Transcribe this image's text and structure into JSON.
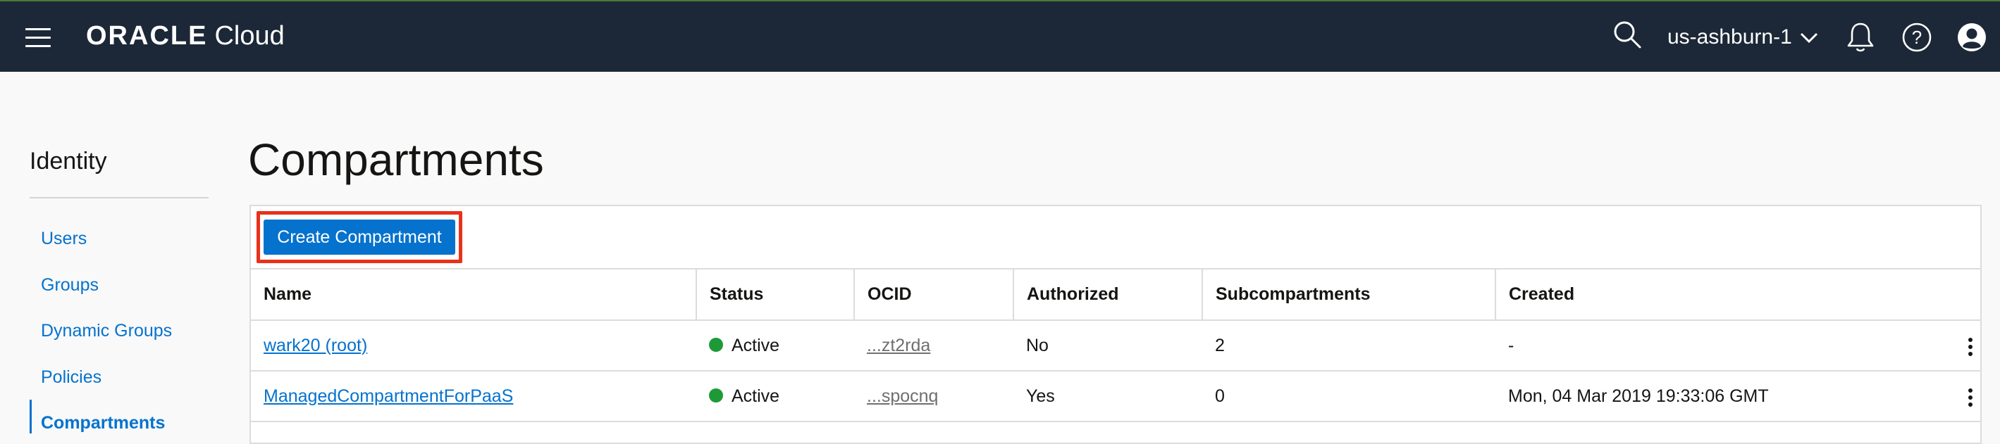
{
  "header": {
    "brand": "ORACLE",
    "product": "Cloud",
    "region": "us-ashburn-1",
    "icons": [
      "menu-icon",
      "search-icon",
      "chevron-down-icon",
      "bell-icon",
      "help-icon",
      "user-icon"
    ]
  },
  "sidebar": {
    "title": "Identity",
    "items": [
      {
        "label": "Users"
      },
      {
        "label": "Groups"
      },
      {
        "label": "Dynamic Groups"
      },
      {
        "label": "Policies"
      },
      {
        "label": "Compartments",
        "active": true
      }
    ]
  },
  "main": {
    "title": "Compartments",
    "create_button": "Create Compartment",
    "columns": [
      "Name",
      "Status",
      "OCID",
      "Authorized",
      "Subcompartments",
      "Created"
    ],
    "rows": [
      {
        "name": "wark20 (root)",
        "status": "Active",
        "ocid": "...zt2rda",
        "authorized": "No",
        "subcompartments": "2",
        "created": "-"
      },
      {
        "name": "ManagedCompartmentForPaaS",
        "status": "Active",
        "ocid": "...spocnq",
        "authorized": "Yes",
        "subcompartments": "0",
        "created": "Mon, 04 Mar 2019 19:33:06 GMT"
      }
    ]
  },
  "colors": {
    "header_bg": "#1c2837",
    "accent": "#0572ce",
    "status_active": "#1d9a37",
    "highlight": "#e8321c"
  }
}
